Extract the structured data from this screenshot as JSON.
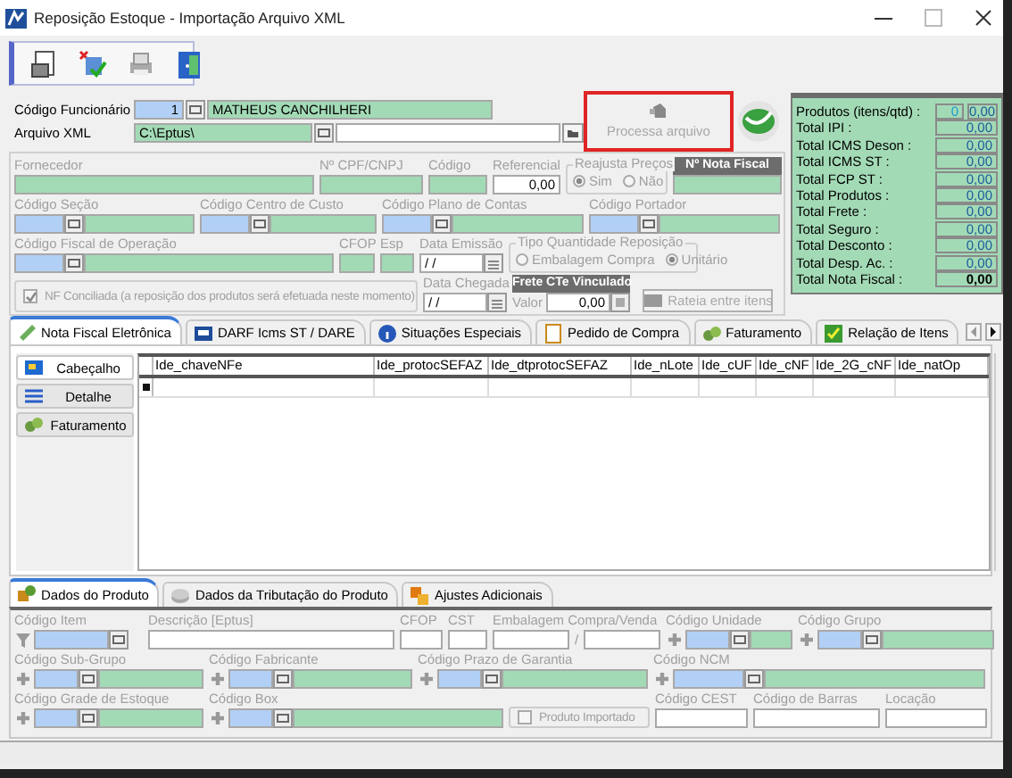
{
  "window": {
    "title": "Reposição Estoque - Importação Arquivo XML"
  },
  "header": {
    "employee": {
      "label": "Código Funcionário",
      "code": "1",
      "name": "MATHEUS CANCHILHERI"
    },
    "xml_file": {
      "label": "Arquivo XML",
      "path": "C:\\Eptus\\"
    },
    "process_button": {
      "label": "Processa arquivo",
      "disabled": true
    }
  },
  "totals": [
    {
      "label": "Produtos (itens/qtd) :",
      "count": "0",
      "value": "0,00",
      "kind": "line"
    },
    {
      "label": "Total IPI :",
      "value": "0,00",
      "kind": "line"
    },
    {
      "label": "Total ICMS Deson :",
      "value": "0,00",
      "kind": "line"
    },
    {
      "label": "Total ICMS ST :",
      "value": "0,00",
      "kind": "line"
    },
    {
      "label": "Total FCP ST :",
      "value": "0,00",
      "kind": "line"
    },
    {
      "label": "Total Produtos :",
      "value": "0,00",
      "kind": "line"
    },
    {
      "label": "Total Frete :",
      "value": "0,00",
      "kind": "line"
    },
    {
      "label": "Total Seguro :",
      "value": "0,00",
      "kind": "line"
    },
    {
      "label": "Total Desconto :",
      "value": "0,00",
      "kind": "line"
    },
    {
      "label": "Total Desp. Ac. :",
      "value": "0,00",
      "kind": "line"
    },
    {
      "label": "Total Nota Fiscal :",
      "value": "0,00",
      "kind": "total"
    }
  ],
  "invoice_rows": [
    [
      {
        "kind": "readonly",
        "label": "Fornecedor"
      },
      {
        "kind": "readonly",
        "label": "Nº CPF/CNPJ"
      },
      {
        "kind": "readonly",
        "label": "Código"
      },
      {
        "kind": "input",
        "label": "Referencial",
        "value": "0,00"
      },
      {
        "kind": "radio_group",
        "title": "Reajusta Preços",
        "options": [
          {
            "label": "Sim",
            "selected": true
          },
          {
            "label": "Não",
            "selected": false
          }
        ]
      },
      {
        "kind": "header_field",
        "title": "Nº Nota Fiscal"
      }
    ],
    [
      {
        "kind": "lookup",
        "label": "Código Seção"
      },
      {
        "kind": "lookup",
        "label": "Código Centro de Custo"
      },
      {
        "kind": "lookup",
        "label": "Código Plano de Contas"
      },
      {
        "kind": "lookup",
        "label": "Código Portador"
      }
    ],
    [
      {
        "kind": "lookup",
        "label": "Código Fiscal de Operação"
      },
      {
        "kind": "readonly",
        "label": "CFOP"
      },
      {
        "kind": "readonly",
        "label": "Esp"
      },
      {
        "kind": "date",
        "label": "Data Emissão",
        "value": "/ /"
      },
      {
        "kind": "radio_group",
        "title": "Tipo Quantidade Reposição",
        "options": [
          {
            "label": "Embalagem Compra",
            "selected": false
          },
          {
            "label": "Unitário",
            "selected": true
          }
        ]
      }
    ],
    [
      {
        "kind": "checkbox",
        "label": "NF Conciliada (a reposição dos produtos será efetuada neste momento)",
        "checked": true
      },
      {
        "kind": "date",
        "label": "Data Chegada",
        "value": "/ /"
      },
      {
        "kind": "frete",
        "title": "Frete CTe Vinculado",
        "label": "Valor",
        "value": "0,00"
      },
      {
        "kind": "button",
        "label": "Rateia entre itens",
        "disabled": true
      }
    ]
  ],
  "tabs": [
    {
      "label": "Nota Fiscal Eletrônica",
      "selected": true
    },
    {
      "label": "DARF Icms ST / DARE",
      "selected": false
    },
    {
      "label": "Situações Especiais",
      "selected": false
    },
    {
      "label": "Pedido de Compra",
      "selected": false
    },
    {
      "label": "Faturamento",
      "selected": false
    },
    {
      "label": "Relação de Itens",
      "selected": false
    }
  ],
  "side_tabs": [
    {
      "label": "Cabeçalho",
      "selected": true
    },
    {
      "label": "Detalhe",
      "selected": false
    },
    {
      "label": "Faturamento",
      "selected": false
    }
  ],
  "grid": {
    "columns": [
      "Ide_chaveNFe",
      "Ide_protocSEFAZ",
      "Ide_dtprotocSEFAZ",
      "Ide_nLote",
      "Ide_cUF",
      "Ide_cNF",
      "Ide_2G_cNF",
      "Ide_natOp"
    ]
  },
  "product_tabs": [
    {
      "label": "Dados do Produto",
      "selected": true
    },
    {
      "label": "Dados da Tributação do Produto",
      "selected": false
    },
    {
      "label": "Ajustes Adicionais",
      "selected": false
    }
  ],
  "product_rows": [
    [
      {
        "kind": "code",
        "label": "Código Item"
      },
      {
        "kind": "input",
        "label": "Descrição [Eptus]"
      },
      {
        "kind": "input",
        "label": "CFOP"
      },
      {
        "kind": "input",
        "label": "CST"
      },
      {
        "kind": "pair",
        "label": "Embalagem Compra/Venda",
        "separator": "/"
      },
      {
        "kind": "lookup",
        "label": "Código Unidade"
      },
      {
        "kind": "lookup",
        "label": "Código Grupo"
      }
    ],
    [
      {
        "kind": "lookup",
        "label": "Código Sub-Grupo"
      },
      {
        "kind": "lookup",
        "label": "Código Fabricante"
      },
      {
        "kind": "lookup",
        "label": "Código Prazo de Garantia"
      },
      {
        "kind": "lookup",
        "label": "Código NCM"
      }
    ],
    [
      {
        "kind": "lookup",
        "label": "Código Grade de Estoque"
      },
      {
        "kind": "lookup",
        "label": "Código Box"
      },
      {
        "kind": "checkbox",
        "label": "Produto Importado",
        "checked": false
      },
      {
        "kind": "input",
        "label": "Código CEST"
      },
      {
        "kind": "input",
        "label": "Código de Barras"
      },
      {
        "kind": "input",
        "label": "Locação"
      }
    ]
  ]
}
